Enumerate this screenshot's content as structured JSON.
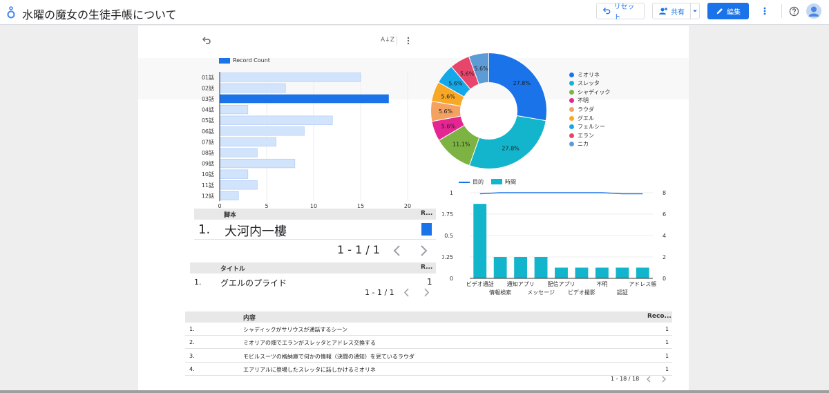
{
  "app": {
    "title": "水曜の魔女の生徒手帳について",
    "reset_label": "リセット",
    "share_label": "共有",
    "edit_label": "編集"
  },
  "colors": {
    "accent": "#1a73e8",
    "bar_light": "#d2e3fc",
    "bar_dark": "#1a73e8",
    "teal": "#12b5cb"
  },
  "toolbar": {
    "sort_label": "A↓Z"
  },
  "bar_chart": {
    "legend": "Record Count",
    "categories": [
      "01話",
      "02話",
      "03話",
      "04話",
      "05話",
      "06話",
      "07話",
      "08話",
      "09話",
      "10話",
      "11話",
      "12話"
    ],
    "values": [
      15,
      7,
      18,
      3,
      12,
      9,
      6,
      4,
      8,
      3,
      4,
      2
    ],
    "highlight_index": 2,
    "xlim": [
      0,
      20
    ],
    "xticks": [
      "0",
      "5",
      "10",
      "15",
      "20"
    ]
  },
  "pie_chart": {
    "legend": [
      "ミオリネ",
      "スレッタ",
      "シャディック",
      "不明",
      "ラウダ",
      "グエル",
      "フェルシー",
      "エラン",
      "ニカ"
    ],
    "values": [
      27.8,
      27.8,
      11.1,
      5.6,
      5.6,
      5.6,
      5.6,
      5.6,
      5.6
    ],
    "labels": [
      "27.8%",
      "27.8%",
      "11.1%",
      "5.6%",
      "5.6%",
      "5.6%",
      "5.6%",
      "5.6%",
      "5.6%"
    ],
    "colors": [
      "#1a73e8",
      "#12b5cb",
      "#7cb342",
      "#e52592",
      "#f4a261",
      "#f9a825",
      "#15a8e8",
      "#e8456b",
      "#5c9bd5"
    ]
  },
  "combo_chart": {
    "legend_line": "目的",
    "legend_bar": "時間",
    "categories": [
      "ビデオ通話",
      "情報検索",
      "通知アプリ",
      "メッセージ",
      "配信アプリ",
      "ビデオ撮影",
      "不明",
      "認証",
      "アドレス帳"
    ],
    "bar_values": [
      0.87,
      0.25,
      0.25,
      0.25,
      0.125,
      0.125,
      0.125,
      0.125,
      0.125
    ],
    "line_values": [
      7.9,
      8,
      8,
      8,
      8,
      8,
      8,
      7.9,
      7.9
    ],
    "left_ticks": [
      "0",
      "0.25",
      "0.5",
      "0.75",
      "1"
    ],
    "right_ticks": [
      "0",
      "2",
      "4",
      "6",
      "8"
    ],
    "ylim_left": [
      0,
      1
    ],
    "ylim_right": [
      0,
      8
    ]
  },
  "table_script": {
    "col1": "脚本",
    "col2": "R...",
    "row_num": "1.",
    "row_text": "大河内一樓",
    "pagination": "1 - 1 / 1"
  },
  "table_title": {
    "col1": "タイトル",
    "col2": "R...",
    "row_num": "1.",
    "row_text": "グエルのプライド",
    "row_value": "1",
    "pagination": "1 - 1 / 1"
  },
  "table_content": {
    "col1": "内容",
    "col2": "Reco...",
    "rows": [
      {
        "num": "1.",
        "text": "シャディックがサリウスが通話するシーン",
        "value": "1"
      },
      {
        "num": "2.",
        "text": "ミオリアの畑でエランがスレッタとアドレス交換する",
        "value": "1"
      },
      {
        "num": "3.",
        "text": "モビルスーツの格納庫で何かの情報（決闘の通知）を見ているラウダ",
        "value": "1"
      },
      {
        "num": "4.",
        "text": "エアリアルに登場したスレッタに話しかけるミオリネ",
        "value": "1"
      }
    ],
    "pagination": "1 - 18 / 18"
  }
}
